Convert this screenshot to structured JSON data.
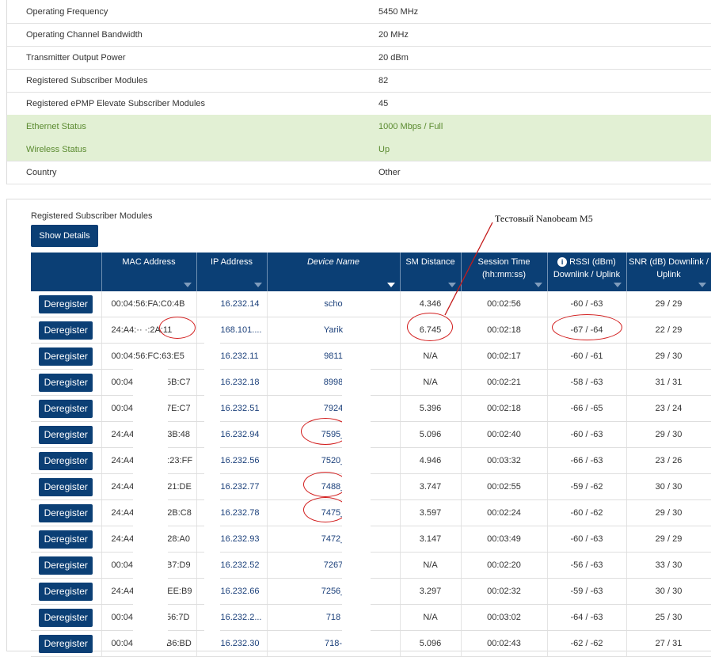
{
  "status": [
    {
      "label": "Operating Frequency",
      "value": "5450 MHz",
      "highlight": false
    },
    {
      "label": "Operating Channel Bandwidth",
      "value": "20 MHz",
      "highlight": false
    },
    {
      "label": "Transmitter Output Power",
      "value": "20 dBm",
      "highlight": false
    },
    {
      "label": "Registered Subscriber Modules",
      "value": "82",
      "highlight": false
    },
    {
      "label": "Registered ePMP Elevate Subscriber Modules",
      "value": "45",
      "highlight": false
    },
    {
      "label": "Ethernet Status",
      "value": "1000 Mbps / Full",
      "highlight": true
    },
    {
      "label": "Wireless Status",
      "value": "Up",
      "highlight": true
    },
    {
      "label": "Country",
      "value": "Other",
      "highlight": false
    }
  ],
  "sm": {
    "title": "Registered Subscriber Modules",
    "show_details": "Show Details",
    "annotation": "Тестовый Nanobeam M5",
    "columns": {
      "mac": "MAC Address",
      "ip": "IP Address",
      "device": "Device Name",
      "distance": "SM Distance",
      "session_1": "Session Time",
      "session_2": "(hh:mm:ss)",
      "rssi_1": "RSSI (dBm)",
      "rssi_2": "Downlink / Uplink",
      "snr_1": "SNR (dB) Downlink /",
      "snr_2": "Uplink",
      "info_icon": "i"
    },
    "deregister_label": "Deregister",
    "rows": [
      {
        "mac": "00:04:56:FA:C0:4B",
        "ip": "16.232.14",
        "device": "scho",
        "distance": "4.346",
        "session": "00:02:56",
        "rssi": "-60 / -63",
        "snr": "29 / 29"
      },
      {
        "mac": "24:A4:·· ·:2A:11",
        "ip": "168.101....",
        "device": "Yarik",
        "distance": "6.745",
        "session": "00:02:18",
        "rssi": "-67 / -64",
        "snr": "22 / 29"
      },
      {
        "mac": "00:04:56:FC:63:E5",
        "ip": "16.232.11",
        "device": "9811",
        "distance": "N/A",
        "session": "00:02:17",
        "rssi": "-60 / -61",
        "snr": "29 / 30"
      },
      {
        "mac": "00:04",
        "mac2": "5B:C7",
        "ip": "16.232.18",
        "device": "8998",
        "distance": "N/A",
        "session": "00:02:21",
        "rssi": "-58 / -63",
        "snr": "31 / 31"
      },
      {
        "mac": "00:04",
        "mac2": "7E:C7",
        "ip": "16.232.51",
        "device": "7924",
        "distance": "5.396",
        "session": "00:02:18",
        "rssi": "-66 / -65",
        "snr": "23 / 24"
      },
      {
        "mac": "24:A4",
        "mac2": "3B:48",
        "ip": "16.232.94",
        "device": "7595_",
        "distance": "5.096",
        "session": "00:02:40",
        "rssi": "-60 / -63",
        "snr": "29 / 30"
      },
      {
        "mac": "24:A4",
        "mac2": ":23:FF",
        "ip": "16.232.56",
        "device": "7520_",
        "distance": "4.946",
        "session": "00:03:32",
        "rssi": "-66 / -63",
        "snr": "23 / 26"
      },
      {
        "mac": "24:A4",
        "mac2": "21:DE",
        "ip": "16.232.77",
        "device": "7488_",
        "distance": "3.747",
        "session": "00:02:55",
        "rssi": "-59 / -62",
        "snr": "30 / 30"
      },
      {
        "mac": "24:A4",
        "mac2": "2B:C8",
        "ip": "16.232.78",
        "device": "7475_",
        "distance": "3.597",
        "session": "00:02:24",
        "rssi": "-60 / -62",
        "snr": "29 / 30"
      },
      {
        "mac": "24:A4",
        "mac2": "28:A0",
        "ip": "16.232.93",
        "device": "7472_",
        "distance": "3.147",
        "session": "00:03:49",
        "rssi": "-60 / -63",
        "snr": "29 / 29"
      },
      {
        "mac": "00:04",
        "mac2": "B7:D9",
        "ip": "16.232.52",
        "device": "7267",
        "distance": "N/A",
        "session": "00:02:20",
        "rssi": "-56 / -63",
        "snr": "33 / 30"
      },
      {
        "mac": "24:A4",
        "mac2": "EE:B9",
        "ip": "16.232.66",
        "device": "7256_",
        "distance": "3.297",
        "session": "00:02:32",
        "rssi": "-59 / -63",
        "snr": "30 / 30"
      },
      {
        "mac": "00:04",
        "mac2": "56:7D",
        "ip": "16.232.2...",
        "device": "718",
        "distance": "N/A",
        "session": "00:03:02",
        "rssi": "-64 / -63",
        "snr": "25 / 30"
      },
      {
        "mac": "00:04",
        "mac2": "B6:BD",
        "ip": "16.232.30",
        "device": "718-",
        "distance": "5.096",
        "session": "00:02:43",
        "rssi": "-62 / -62",
        "snr": "27 / 31"
      }
    ]
  }
}
